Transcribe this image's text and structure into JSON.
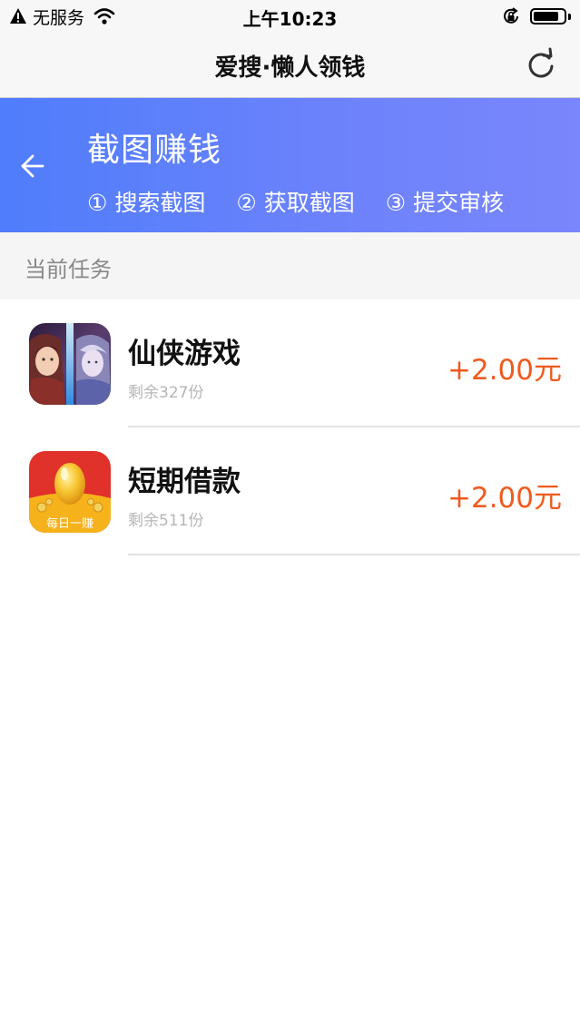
{
  "status_bar": {
    "carrier": "无服务",
    "time": "上午10:23",
    "battery_level": 0.85
  },
  "nav": {
    "title": "爱搜·懒人领钱"
  },
  "header": {
    "title": "截图赚钱",
    "steps": [
      "① 搜索截图",
      "② 获取截图",
      "③ 提交审核"
    ]
  },
  "section": {
    "label": "当前任务"
  },
  "tasks": [
    {
      "name": "仙侠游戏",
      "remaining": "剩余327份",
      "reward": "+2.00元",
      "icon": "xianxia-game-icon"
    },
    {
      "name": "短期借款",
      "remaining": "剩余511份",
      "reward": "+2.00元",
      "icon": "daily-earn-egg-icon",
      "icon_label": "每日一赚"
    }
  ],
  "colors": {
    "header_gradient_start": "#4f7dfb",
    "header_gradient_end": "#7a86fb",
    "reward": "#f05a1e",
    "loan_icon_red": "#e0312b",
    "loan_icon_gold": "#f6b21b"
  }
}
